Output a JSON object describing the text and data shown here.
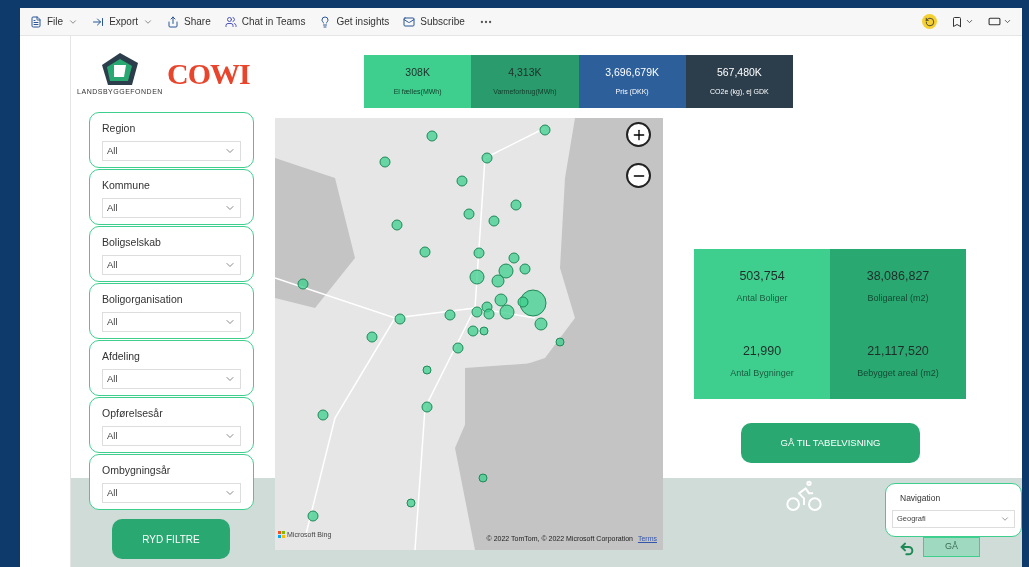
{
  "toolbar": {
    "items": [
      {
        "label": "File",
        "dropdown": true
      },
      {
        "label": "Export",
        "dropdown": true
      },
      {
        "label": "Share",
        "dropdown": false
      },
      {
        "label": "Chat in Teams",
        "dropdown": false
      },
      {
        "label": "Get insights",
        "dropdown": false
      },
      {
        "label": "Subscribe",
        "dropdown": false
      }
    ]
  },
  "logos": {
    "left_caption": "LANDSBYGGEFONDEN",
    "right": "COWI"
  },
  "kpi_strip": [
    {
      "value": "308K",
      "label": "El fælles(MWh)",
      "color": "#3ecf8e"
    },
    {
      "value": "4,313K",
      "label": "Varmeforbrug(MWh)",
      "color": "#2a9b6c"
    },
    {
      "value": "3,696,679K",
      "label": "Pris (DKK)",
      "color": "#2d5f9a"
    },
    {
      "value": "567,480K",
      "label": "CO2e (kg), ej GDK",
      "color": "#2c3e4c"
    }
  ],
  "filters": [
    {
      "label": "Region",
      "value": "All"
    },
    {
      "label": "Kommune",
      "value": "All"
    },
    {
      "label": "Boligselskab",
      "value": "All"
    },
    {
      "label": "Boligorganisation",
      "value": "All"
    },
    {
      "label": "Afdeling",
      "value": "All"
    },
    {
      "label": "Opførelsesår",
      "value": "All"
    },
    {
      "label": "Ombygningsår",
      "value": "All"
    }
  ],
  "clear_button": "RYD FILTRE",
  "map": {
    "brand": "Microsoft Bing",
    "attribution": "© 2022 TomTom, © 2022 Microsoft Corporation",
    "terms": "Terms"
  },
  "kpi_grid": [
    {
      "value": "503,754",
      "label": "Antal Boliger",
      "color": "#3ecf8e"
    },
    {
      "value": "38,086,827",
      "label": "Boligareal (m2)",
      "color": "#2aa872"
    },
    {
      "value": "21,990",
      "label": "Antal Bygninger",
      "color": "#3ecf8e"
    },
    {
      "value": "21,117,520",
      "label": "Bebygget areal (m2)",
      "color": "#2aa872"
    }
  ],
  "table_button": "GÅ TIL TABELVISNING",
  "navigation": {
    "label": "Navigation",
    "value": "Geografi",
    "go_button": "GÅ"
  }
}
